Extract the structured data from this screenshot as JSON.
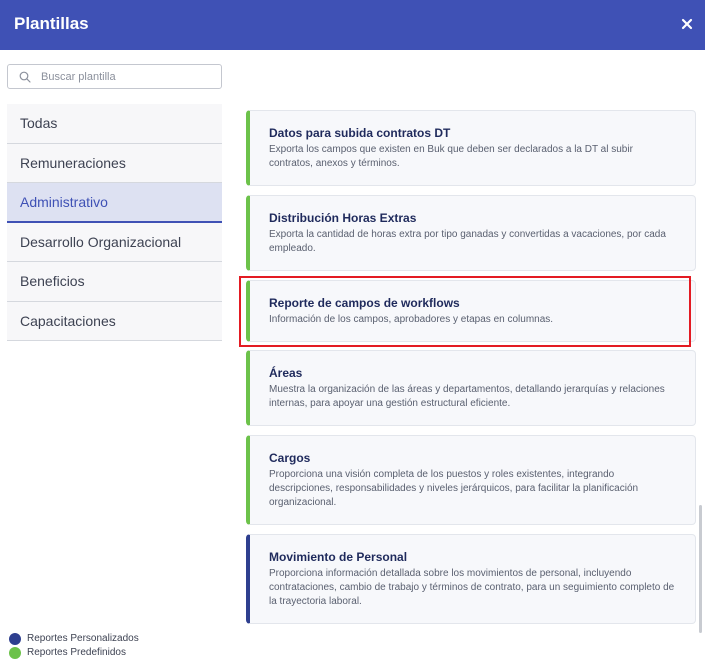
{
  "header": {
    "title": "Plantillas"
  },
  "search": {
    "placeholder": "Buscar plantilla"
  },
  "sidebar": {
    "items": [
      {
        "label": "Todas"
      },
      {
        "label": "Remuneraciones"
      },
      {
        "label": "Administrativo"
      },
      {
        "label": "Desarrollo Organizacional"
      },
      {
        "label": "Beneficios"
      },
      {
        "label": "Capacitaciones"
      }
    ],
    "active": "Administrativo"
  },
  "templates": [
    {
      "title": "Datos para subida contratos DT",
      "description": "Exporta los campos que existen en Buk que deben ser declarados a la DT al subir contratos, anexos y términos."
    },
    {
      "title": "Distribución Horas Extras",
      "description": "Exporta la cantidad de horas extra por tipo ganadas y convertidas a vacaciones, por cada empleado."
    },
    {
      "title": "Reporte de campos de workflows",
      "description": "Información de los campos, aprobadores y etapas en columnas."
    },
    {
      "title": "Áreas",
      "description": "Muestra la organización de las áreas y departamentos, detallando jerarquías y relaciones internas, para apoyar una gestión estructural eficiente."
    },
    {
      "title": "Cargos",
      "description": "Proporciona una visión completa de los puestos y roles existentes, integrando descripciones, responsabilidades y niveles jerárquicos, para facilitar la planificación organizacional."
    },
    {
      "title": "Movimiento de Personal",
      "description": "Proporciona información detallada sobre los movimientos de personal, incluyendo contrataciones, cambio de trabajo y términos de contrato, para un seguimiento completo de la trayectoria laboral."
    }
  ],
  "legend": {
    "custom_label": "Reportes Personalizados",
    "predefined_label": "Reportes Predefinidos"
  },
  "colors": {
    "header": "#3f51b5",
    "custom": "#2e3f8f",
    "predefined": "#6cc24a",
    "highlight": "#e31b23"
  }
}
